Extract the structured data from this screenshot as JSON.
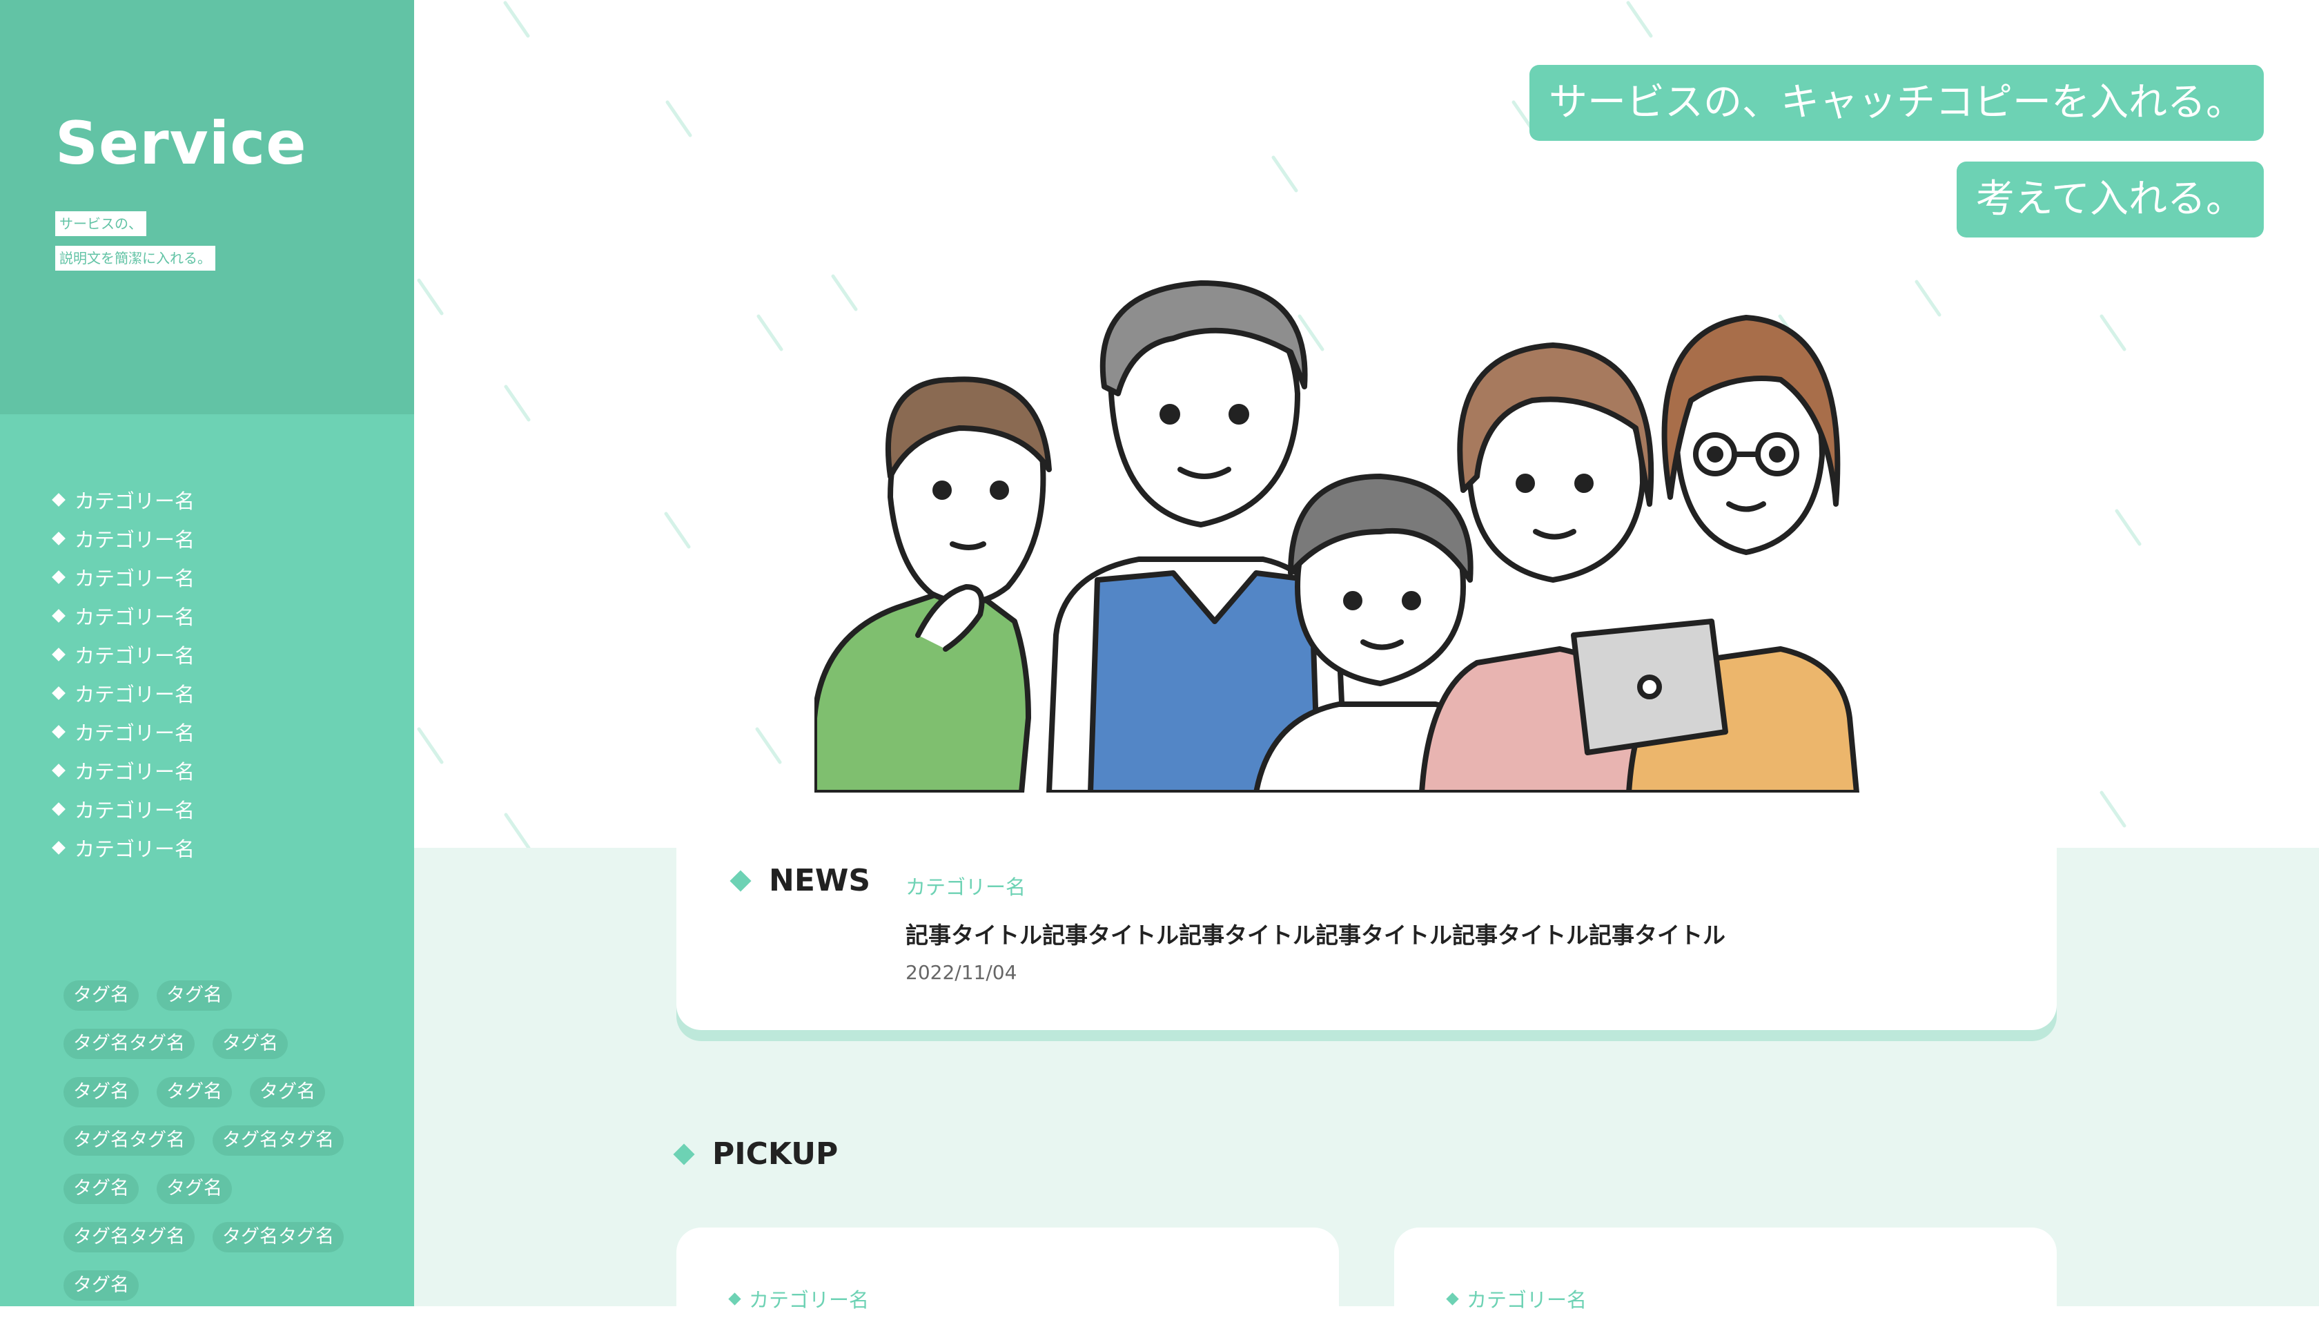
{
  "brand": {
    "name": "Service",
    "description_lines": [
      "サービスの、",
      "説明文を簡潔に入れる。"
    ]
  },
  "sidebar": {
    "categories": [
      "カテゴリー名",
      "カテゴリー名",
      "カテゴリー名",
      "カテゴリー名",
      "カテゴリー名",
      "カテゴリー名",
      "カテゴリー名",
      "カテゴリー名",
      "カテゴリー名",
      "カテゴリー名"
    ],
    "tags": [
      "タグ名",
      "タグ名",
      "タグ名タグ名",
      "タグ名",
      "タグ名",
      "タグ名",
      "タグ名",
      "タグ名タグ名",
      "タグ名タグ名",
      "タグ名",
      "タグ名",
      "タグ名タグ名",
      "タグ名タグ名",
      "タグ名"
    ]
  },
  "hero": {
    "catch_lines": [
      "サービスの、キャッチコピーを入れる。",
      "考えて入れる。"
    ],
    "illustration_icon": "people-group-illustration"
  },
  "news": {
    "heading": "NEWS",
    "category": "カテゴリー名",
    "title": "記事タイトル記事タイトル記事タイトル記事タイトル記事タイトル記事タイトル",
    "date": "2022/11/04"
  },
  "pickup": {
    "heading": "PICKUP",
    "cards": [
      {
        "category": "カテゴリー名"
      },
      {
        "category": "カテゴリー名"
      }
    ]
  },
  "colors": {
    "accent": "#6dd2b4",
    "accent_dark": "#62c3a5",
    "background_tint": "#e8f6f1",
    "text": "#222222"
  }
}
